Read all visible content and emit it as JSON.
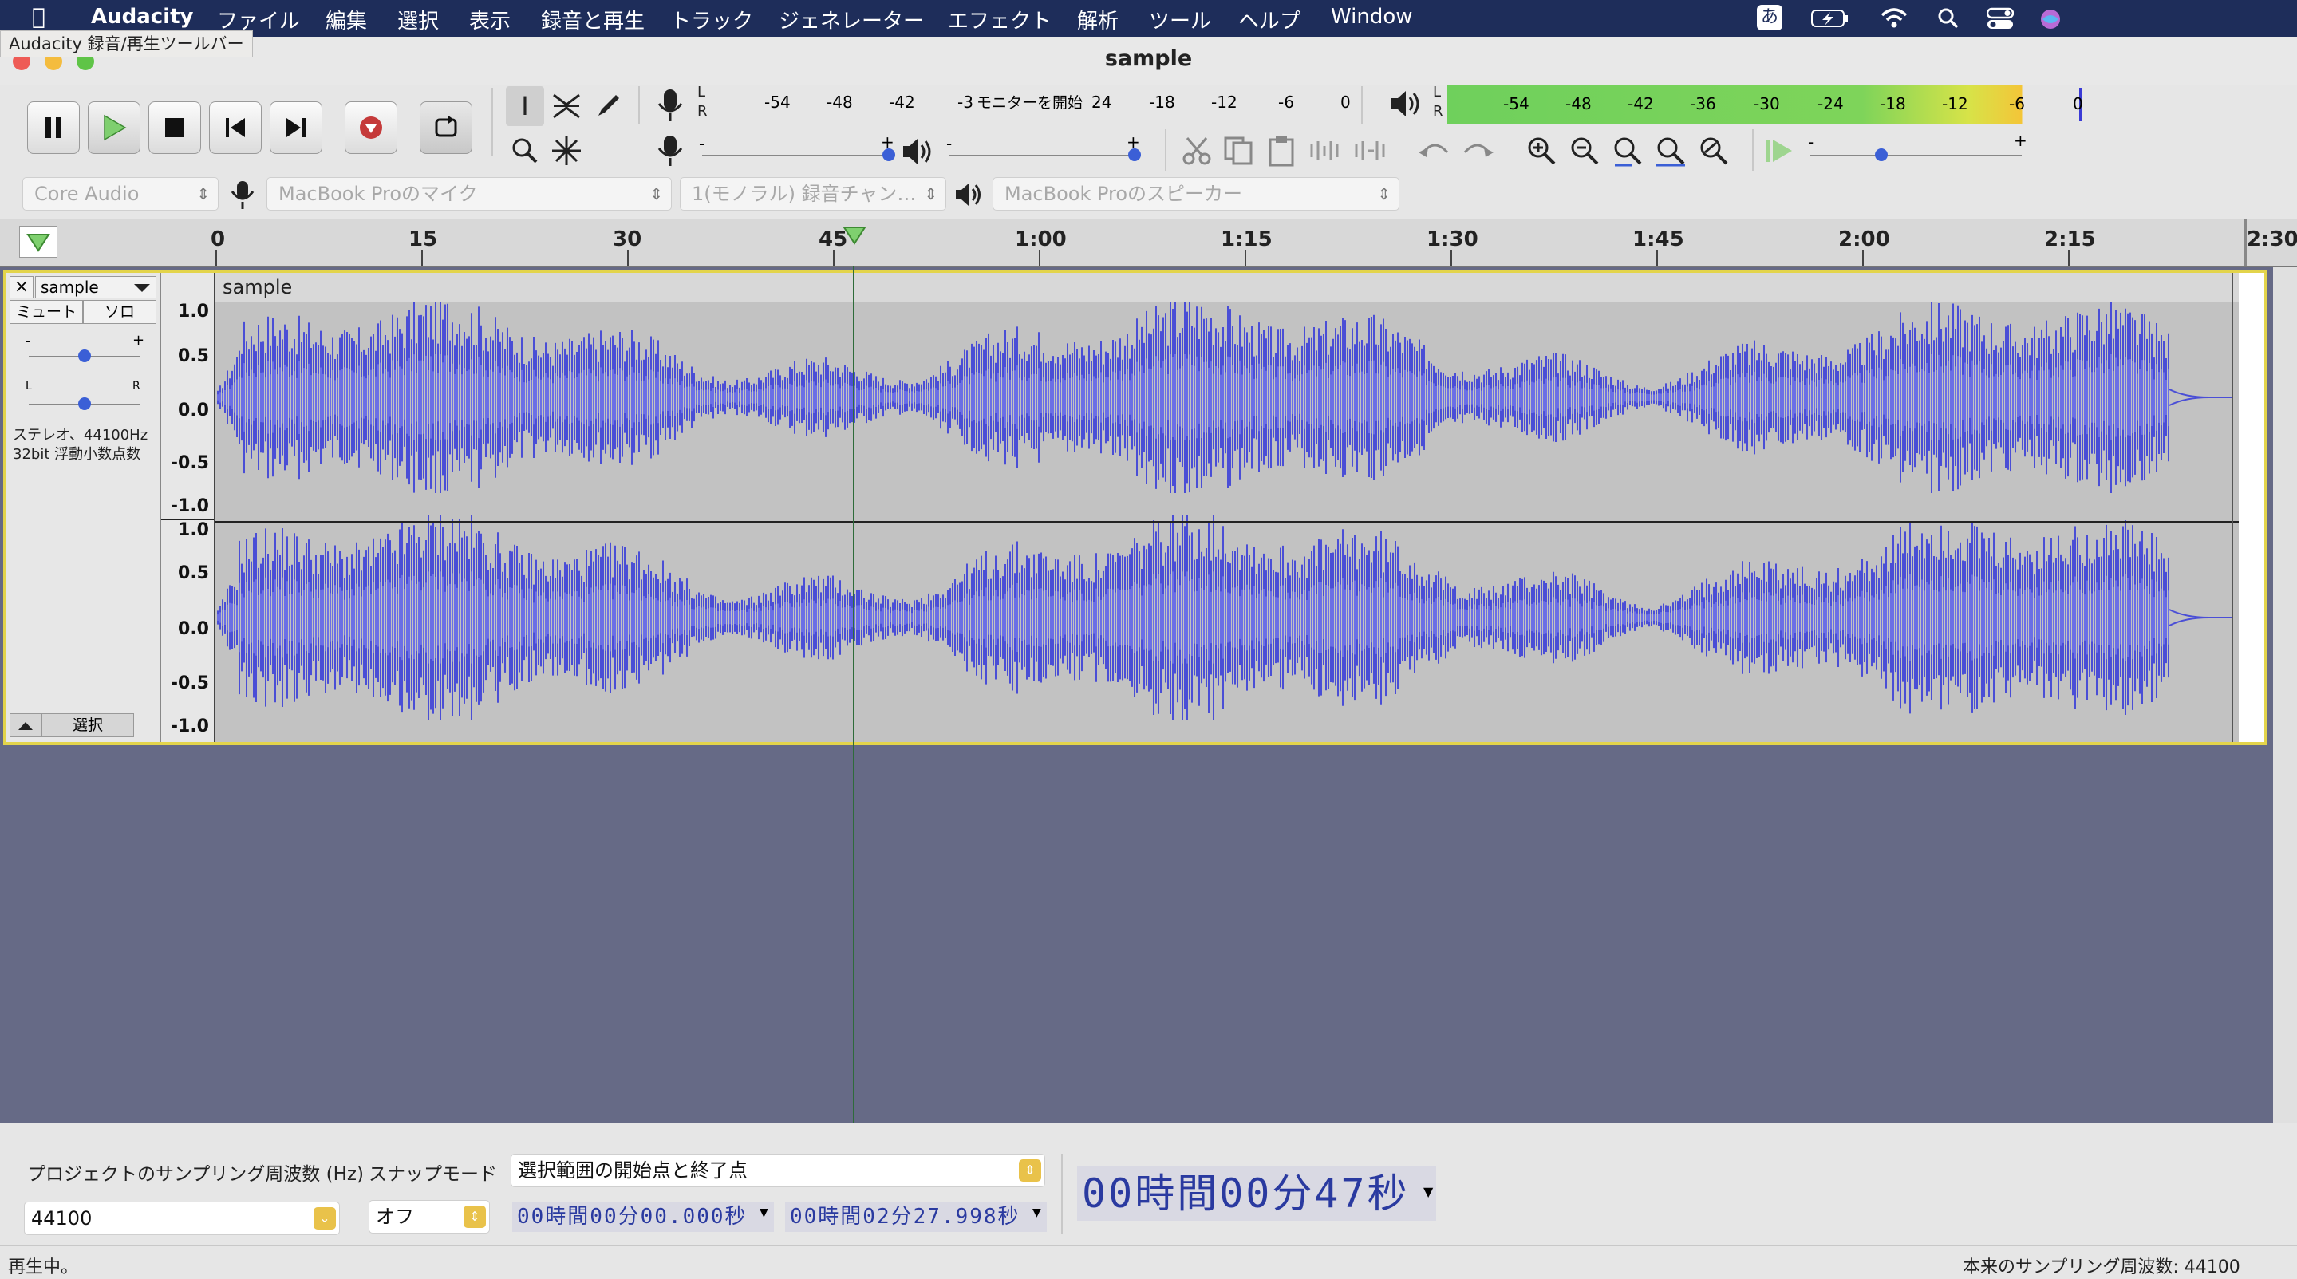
{
  "menubar": {
    "app_name": "Audacity",
    "items": [
      "ファイル",
      "編集",
      "選択",
      "表示",
      "録音と再生",
      "トラック",
      "ジェネレーター",
      "エフェクト",
      "解析",
      "ツール",
      "ヘルプ",
      "Window"
    ],
    "input_method": "あ"
  },
  "tooltip": "Audacity 録音/再生ツールバー",
  "window": {
    "title": "sample"
  },
  "meters": {
    "rec_channels": [
      "L",
      "R"
    ],
    "rec_ticks": [
      "-54",
      "-48",
      "-42",
      "-3",
      "24",
      "-18",
      "-12",
      "-6",
      "0"
    ],
    "rec_monitor_label": "モニターを開始",
    "play_channels": [
      "L",
      "R"
    ],
    "play_ticks": [
      "-54",
      "-48",
      "-42",
      "-36",
      "-30",
      "-24",
      "-18",
      "-12",
      "-6",
      "0"
    ],
    "rec_volume_minus": "-",
    "rec_volume_plus": "+",
    "play_volume_minus": "-",
    "play_volume_plus": "+",
    "speed_minus": "-",
    "speed_plus": "+"
  },
  "devices": {
    "host": "Core Audio",
    "input": "MacBook Proのマイク",
    "channels": "1(モノラル) 録音チャン…",
    "output": "MacBook Proのスピーカー"
  },
  "timeline": {
    "ticks": [
      "0",
      "15",
      "30",
      "45",
      "1:00",
      "1:15",
      "1:30",
      "1:45",
      "2:00",
      "2:15",
      "2:30"
    ],
    "playhead_seconds": 47
  },
  "track": {
    "name": "sample",
    "clip_name": "sample",
    "mute": "ミュート",
    "solo": "ソロ",
    "gain_minus": "-",
    "gain_plus": "+",
    "pan_left": "L",
    "pan_right": "R",
    "info_line1": "ステレオ、44100Hz",
    "info_line2": "32bit 浮動小数点数",
    "select": "選択",
    "scale_labels": [
      "1.0",
      "0.5",
      "0.0",
      "-0.5",
      "-1.0"
    ],
    "wave_color": "#4a4ed6",
    "selection_color": "#e3d44b"
  },
  "selectionbar": {
    "rate_label": "プロジェクトのサンプリング周波数 (Hz)",
    "rate_value": "44100",
    "snap_label": "スナップモード",
    "snap_value": "オフ",
    "selection_mode": "選択範囲の開始点と終了点",
    "start_time": "00時間00分00.000秒",
    "end_time": "00時間02分27.998秒",
    "audio_position": "00時間00分47秒"
  },
  "status": {
    "left": "再生中。",
    "right": "本来のサンプリング周波数: 44100"
  }
}
